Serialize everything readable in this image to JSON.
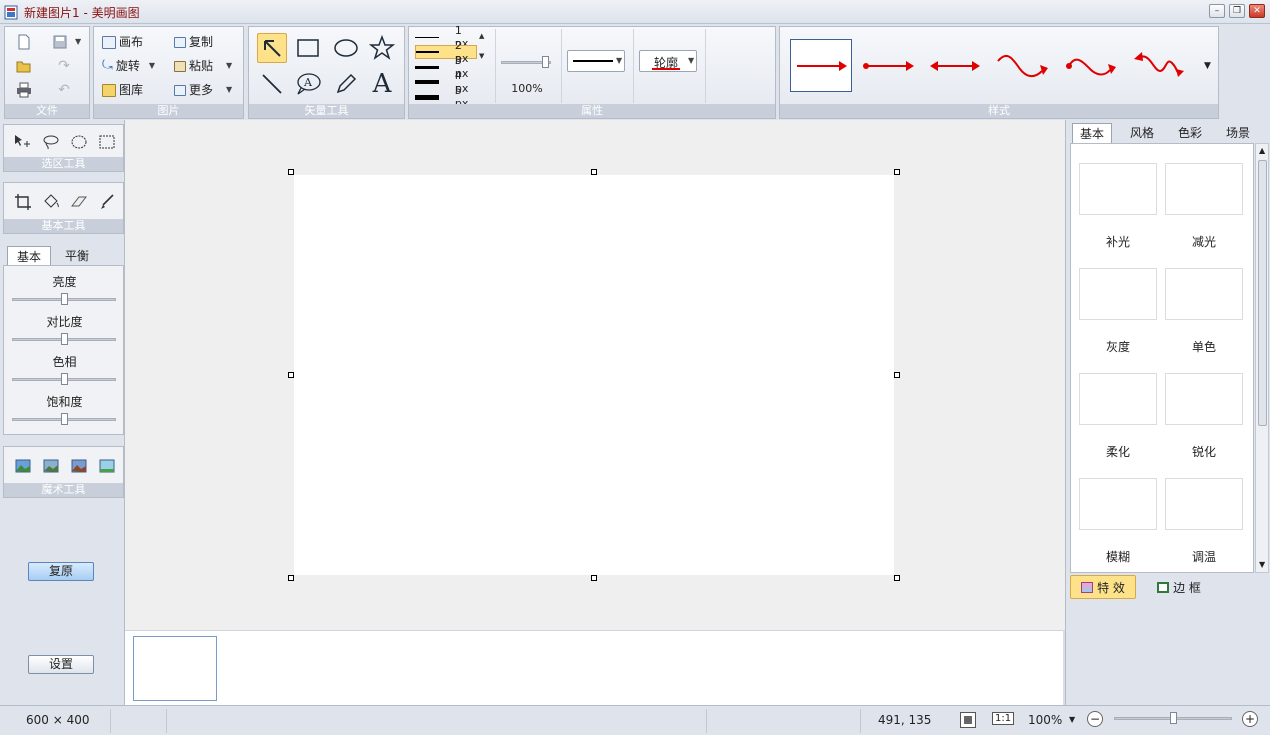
{
  "window": {
    "title": "新建图片1 - 美明画图",
    "minimize_glyph": "–",
    "restore_glyph": "❐",
    "close_glyph": "✕"
  },
  "ribbon": {
    "file_group": {
      "label": "文件"
    },
    "image_group": {
      "label": "图片",
      "canvas_label": "画布",
      "rotate_label": "旋转",
      "library_label": "图库",
      "copy_label": "复制",
      "paste_label": "粘贴",
      "more_label": "更多"
    },
    "vector_group": {
      "label": "矢量工具"
    },
    "properties_group": {
      "label": "属性",
      "line_widths": [
        "1 px",
        "2 px",
        "3 px",
        "4 px",
        "5 px"
      ],
      "selected_width": "2 px",
      "opacity": "100%",
      "outline_label": "轮廓"
    },
    "style_group": {
      "label": "样式"
    }
  },
  "left_panel": {
    "selection_tools_label": "选区工具",
    "basic_tools_label": "基本工具",
    "adjust_tabs": [
      "基本",
      "平衡"
    ],
    "adjustments": [
      {
        "label": "亮度",
        "value": 0.5
      },
      {
        "label": "对比度",
        "value": 0.5
      },
      {
        "label": "色相",
        "value": 0.5
      },
      {
        "label": "饱和度",
        "value": 0.5
      }
    ],
    "magic_tools_label": "魔术工具",
    "reset_button": "复原",
    "settings_button": "设置"
  },
  "right_panel": {
    "tabs": [
      "基本",
      "风格",
      "色彩",
      "场景"
    ],
    "effects": [
      "补光",
      "减光",
      "灰度",
      "单色",
      "柔化",
      "锐化",
      "模糊",
      "调温"
    ],
    "bottom_tabs": {
      "effects": "特 效",
      "border": "边 框"
    }
  },
  "status": {
    "image_size": "600 × 400",
    "cursor_pos": "491, 135",
    "one_to_one": "1:1",
    "zoom": "100%",
    "zoom_out": "−",
    "zoom_in": "+"
  },
  "colors": {
    "accent_red": "#e00000",
    "highlight": "#fde28a"
  }
}
